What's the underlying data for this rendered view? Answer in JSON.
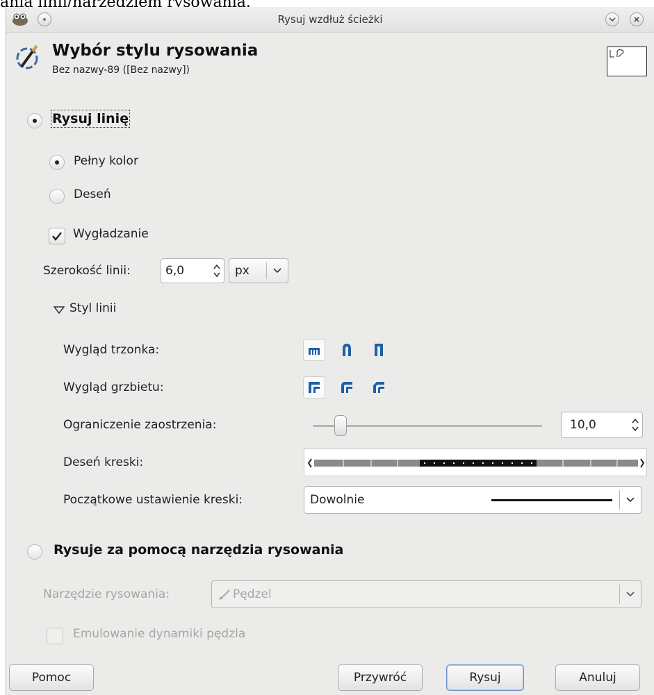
{
  "caption_fragment": "ania linii/narzędziem rysowania.",
  "window": {
    "title": "Rysuj wzdłuż ścieżki"
  },
  "header": {
    "title": "Wybór stylu rysowania",
    "subtitle": "Bez nazwy-89 ([Bez nazwy])"
  },
  "stroke_line": {
    "label": "Rysuj linię",
    "selected": true,
    "solid_color": {
      "label": "Pełny kolor",
      "selected": true
    },
    "pattern": {
      "label": "Deseń",
      "selected": false
    },
    "antialias": {
      "label": "Wygładzanie",
      "checked": true
    },
    "line_width": {
      "label": "Szerokość linii:",
      "value": "6,0",
      "unit": "px"
    },
    "line_style": {
      "label": "Styl linii",
      "cap_label": "Wygląd trzonka:",
      "join_label": "Wygląd grzbietu:",
      "miter_label": "Ograniczenie zaostrzenia:",
      "miter_value": "10,0",
      "miter_fraction": 0.1,
      "dash_label": "Deseń kreski:",
      "dash_preset_label": "Początkowe ustawienie kreski:",
      "dash_preset_value": "Dowolnie"
    }
  },
  "stroke_tool": {
    "label": "Rysuje za pomocą narzędzia rysowania",
    "selected": false,
    "tool_label": "Narzędzie rysowania:",
    "tool_value": "Pędzel",
    "emulate_label": "Emulowanie dynamiki pędzla",
    "emulate_checked": false
  },
  "buttons": {
    "help": "Pomoc",
    "reset": "Przywróć",
    "stroke": "Rysuj",
    "cancel": "Anuluj"
  },
  "colors": {
    "accent": "#1f5fa8",
    "window_bg": "#ebebea"
  }
}
